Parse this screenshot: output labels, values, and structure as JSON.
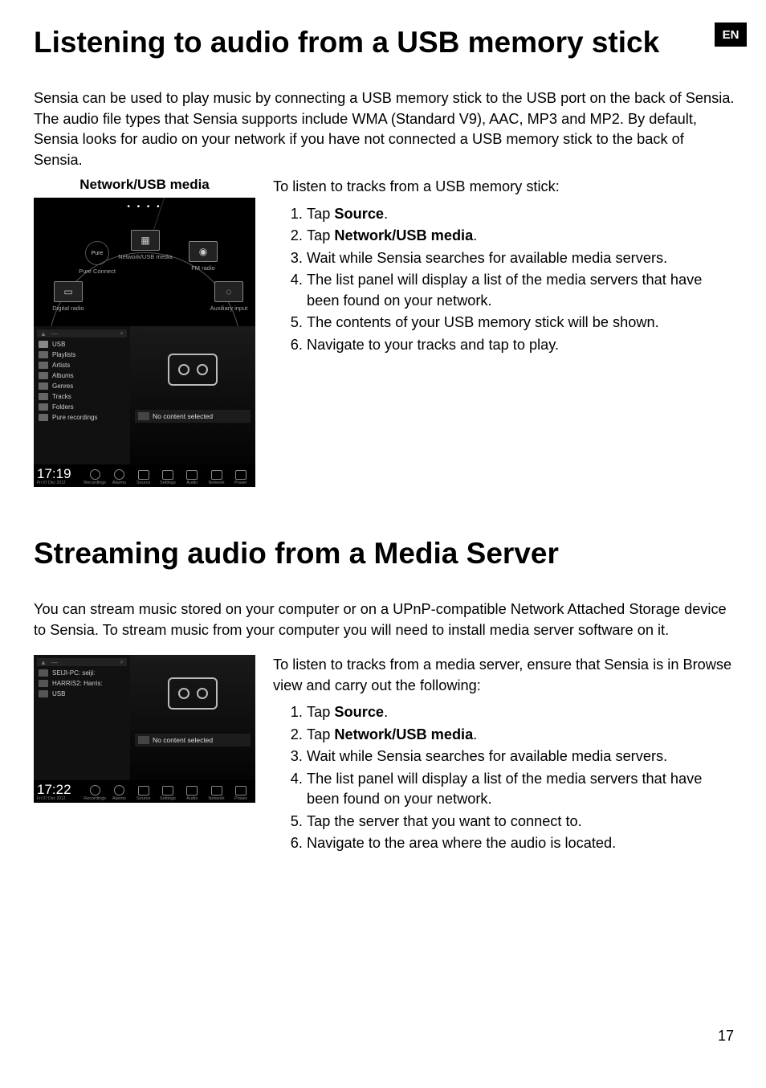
{
  "lang_badge": "EN",
  "page_number": "17",
  "section1": {
    "heading": "Listening to audio from a USB memory stick",
    "intro": "Sensia can be used to play music by connecting a USB memory stick to the USB port on the back of Sensia. The audio file types that Sensia supports include WMA (Standard V9), AAC, MP3 and MP2. By default, Sensia looks for audio on your network if you have not connected a USB memory stick to the back of Sensia.",
    "figure_caption": "Network/USB media",
    "lead": "To listen to tracks from a USB memory stick:",
    "steps": [
      {
        "pre": "Tap ",
        "bold": "Source",
        "post": "."
      },
      {
        "pre": "Tap ",
        "bold": "Network/USB media",
        "post": "."
      },
      {
        "pre": "Wait while Sensia searches for available media servers.",
        "bold": "",
        "post": ""
      },
      {
        "pre": "The list panel will display a list of the  media servers that have been found on your network.",
        "bold": "",
        "post": ""
      },
      {
        "pre": "The contents of your USB memory stick will be shown.",
        "bold": "",
        "post": ""
      },
      {
        "pre": "Navigate to your tracks and tap to play.",
        "bold": "",
        "post": ""
      }
    ],
    "screenshot": {
      "sources": {
        "pure_connect": "Pure Connect",
        "network_usb": "Network/USB media",
        "fm_radio": "FM radio",
        "digital_radio": "Digital radio",
        "aux_input": "Auxiliary input"
      },
      "browser_items": [
        "USB",
        "Playlists",
        "Artists",
        "Albums",
        "Genres",
        "Tracks",
        "Folders",
        "Pure recordings"
      ],
      "no_content": "No content selected",
      "clock": "17:19",
      "date": "Fri 07 Dec 2012",
      "statusbar": [
        "Recordings",
        "Alarms",
        "Source",
        "Settings",
        "Audio",
        "Network",
        "Power"
      ]
    }
  },
  "section2": {
    "heading": "Streaming audio from a Media Server",
    "intro": "You can stream music stored on your computer or on a UPnP-compatible Network Attached Storage device to Sensia. To stream music from your computer you will need to install media server software on it.",
    "lead": "To listen to tracks from a media server, ensure that Sensia is in Browse view and carry out the following:",
    "steps": [
      {
        "pre": "Tap ",
        "bold": "Source",
        "post": "."
      },
      {
        "pre": "Tap ",
        "bold": "Network/USB media",
        "post": "."
      },
      {
        "pre": "Wait while Sensia searches for available media servers.",
        "bold": "",
        "post": ""
      },
      {
        "pre": "The list panel will display a list of the media servers that have been found on your network.",
        "bold": "",
        "post": ""
      },
      {
        "pre": "Tap the server that you want to connect to.",
        "bold": "",
        "post": ""
      },
      {
        "pre": "Navigate to the area where the audio is located.",
        "bold": "",
        "post": ""
      }
    ],
    "screenshot": {
      "servers": [
        "SEIJI-PC: seiji:",
        "HARRIS2: Harris:",
        "USB"
      ],
      "no_content": "No content selected",
      "clock": "17:22",
      "date": "Fri 07 Dec 2012",
      "statusbar": [
        "Recordings",
        "Alarms",
        "Source",
        "Settings",
        "Audio",
        "Network",
        "Power"
      ]
    }
  }
}
